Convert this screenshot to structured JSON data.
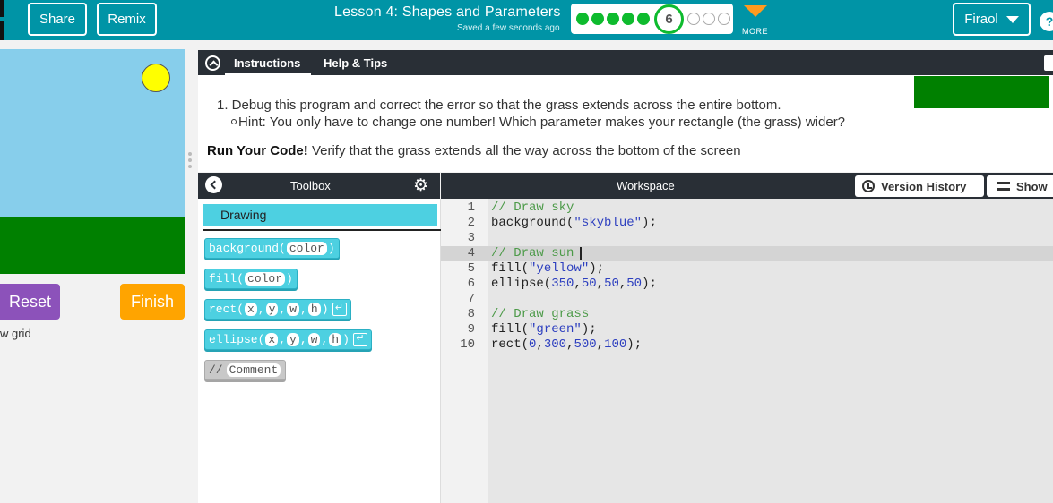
{
  "header": {
    "share_label": "Share",
    "remix_label": "Remix",
    "lesson_title": "Lesson 4: Shapes and Parameters",
    "saved_status": "Saved a few seconds ago",
    "progress": {
      "completed": 5,
      "current": "6",
      "remaining": 3
    },
    "more_label": "MORE",
    "user_name": "Firaol",
    "help_label": "?"
  },
  "visualization": {
    "reset_label": "Reset",
    "finish_label": "Finish",
    "grid_label": "w grid"
  },
  "instructions": {
    "tabs": [
      "Instructions",
      "Help & Tips"
    ],
    "step": "1. Debug this program and correct the error so that the grass extends across the entire bottom.",
    "hint": "Hint: You only have to change one number! Which parameter makes your rectangle (the grass) wider?",
    "run_bold": "Run Your Code!",
    "run_text": " Verify that the grass extends all the way across the bottom of the screen"
  },
  "toolbox": {
    "title": "Toolbox",
    "category": "Drawing",
    "blocks": [
      {
        "name": "background",
        "params": [
          "color"
        ],
        "ret": false
      },
      {
        "name": "fill",
        "params": [
          "color"
        ],
        "ret": false
      },
      {
        "name": "rect",
        "params": [
          "x",
          "y",
          "w",
          "h"
        ],
        "ret": true
      },
      {
        "name": "ellipse",
        "params": [
          "x",
          "y",
          "w",
          "h"
        ],
        "ret": true
      }
    ],
    "comment_block": {
      "prefix": "//",
      "label": "Comment"
    }
  },
  "workspace": {
    "title": "Workspace",
    "version_history_label": "Version History",
    "show_label": "Show",
    "code_lines": [
      {
        "n": "1",
        "text": "// Draw sky"
      },
      {
        "n": "2",
        "text": "background(\"skyblue\");"
      },
      {
        "n": "3",
        "text": ""
      },
      {
        "n": "4",
        "text": "// Draw sun"
      },
      {
        "n": "5",
        "text": "fill(\"yellow\");"
      },
      {
        "n": "6",
        "text": "ellipse(350,50,50,50);"
      },
      {
        "n": "7",
        "text": ""
      },
      {
        "n": "8",
        "text": "// Draw grass"
      },
      {
        "n": "9",
        "text": "fill(\"green\");"
      },
      {
        "n": "10",
        "text": "rect(0,300,500,100);"
      }
    ]
  },
  "colors": {
    "header_bg": "#0094a6",
    "sky": "#87ceeb",
    "sun": "#ffff00",
    "grass": "#008000",
    "reset": "#8c52ba",
    "finish": "#ffa400",
    "block": "#4dd0e1",
    "progress_done": "#0ebb2e"
  }
}
